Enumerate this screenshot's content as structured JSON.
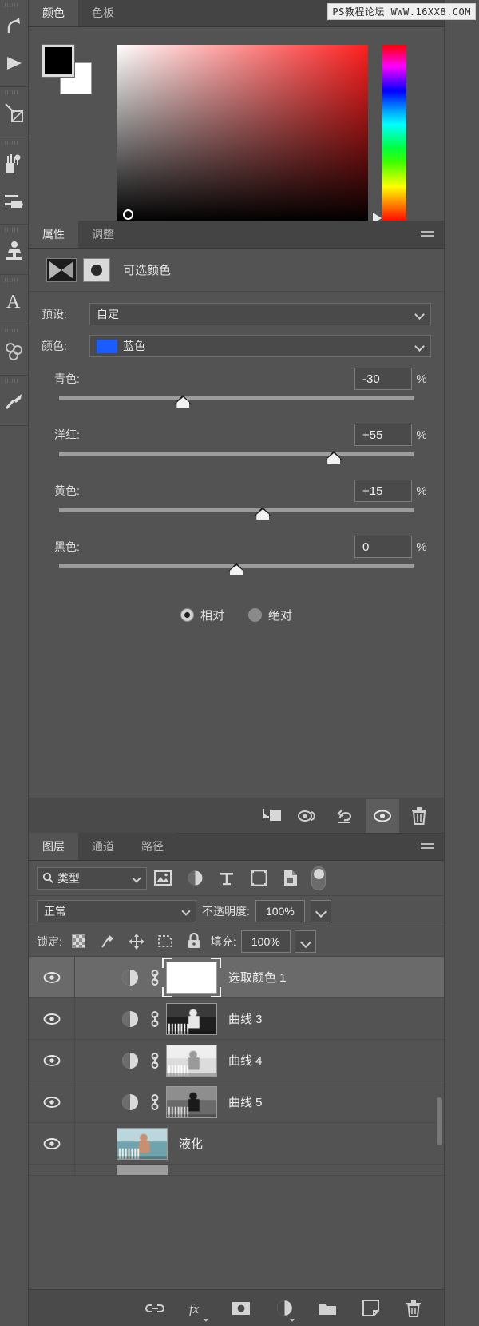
{
  "watermark": "PS教程论坛 WWW.16XX8.COM",
  "toolbar": {
    "tools": [
      {
        "name": "history-brush-tool",
        "glyph": "undo-arrow"
      },
      {
        "name": "gradient-tool",
        "glyph": "triangle-right"
      },
      {
        "name": "pen-tool",
        "glyph": "pen"
      },
      {
        "name": "brush-tool",
        "glyph": "brush-set"
      },
      {
        "name": "eraser-tool",
        "glyph": "eraser"
      },
      {
        "name": "clone-stamp-tool",
        "glyph": "stamp"
      },
      {
        "name": "type-tool",
        "glyph": "letter-a"
      },
      {
        "name": "blur-tool",
        "glyph": "blur"
      },
      {
        "name": "dodge-tool",
        "glyph": "dodge"
      }
    ]
  },
  "color_panel": {
    "tabs": [
      {
        "label": "颜色",
        "active": true
      },
      {
        "label": "色板",
        "active": false
      }
    ],
    "foreground": "#000000",
    "background": "#ffffff",
    "spectrum_base": "#ff1f1f"
  },
  "properties_panel": {
    "tabs": [
      {
        "label": "属性",
        "active": true
      },
      {
        "label": "调整",
        "active": false
      }
    ],
    "adjustment_title": "可选颜色",
    "preset": {
      "label": "预设:",
      "value": "自定"
    },
    "color": {
      "label": "颜色:",
      "value": "蓝色",
      "swatch": "#1a5cff"
    },
    "sliders": [
      {
        "label": "青色:",
        "value": "-30",
        "unit": "%",
        "pos": 35
      },
      {
        "label": "洋红:",
        "value": "+55",
        "unit": "%",
        "pos": 77.5
      },
      {
        "label": "黄色:",
        "value": "+15",
        "unit": "%",
        "pos": 57.5
      },
      {
        "label": "黑色:",
        "value": "0",
        "unit": "%",
        "pos": 50
      }
    ],
    "method": [
      {
        "label": "相对",
        "selected": true
      },
      {
        "label": "绝对",
        "selected": false
      }
    ],
    "footer_buttons": [
      {
        "name": "clip-to-layer-button",
        "active": false
      },
      {
        "name": "preview-toggle-button",
        "active": false
      },
      {
        "name": "reset-button",
        "active": false
      },
      {
        "name": "visibility-toggle-button",
        "active": true
      },
      {
        "name": "delete-adjustment-button",
        "active": false
      }
    ]
  },
  "layers_panel": {
    "tabs": [
      {
        "label": "图层",
        "active": true
      },
      {
        "label": "通道",
        "active": false
      },
      {
        "label": "路径",
        "active": false
      }
    ],
    "filter": {
      "value": "类型"
    },
    "filter_icons": [
      {
        "name": "filter-pixel-icon"
      },
      {
        "name": "filter-adjustment-icon"
      },
      {
        "name": "filter-type-icon"
      },
      {
        "name": "filter-shape-icon"
      },
      {
        "name": "filter-smart-object-icon"
      }
    ],
    "blend_mode": "正常",
    "opacity": {
      "label": "不透明度:",
      "value": "100%"
    },
    "lock": {
      "label": "锁定:",
      "fill_label": "填充:",
      "fill_value": "100%"
    },
    "lock_icons": [
      {
        "name": "lock-transparency-icon"
      },
      {
        "name": "lock-image-icon"
      },
      {
        "name": "lock-position-icon"
      },
      {
        "name": "lock-artboard-icon"
      },
      {
        "name": "lock-all-icon"
      }
    ],
    "layers": [
      {
        "name": "选取颜色 1",
        "type": "adjustment",
        "selected": true,
        "visible": true,
        "linked": true,
        "thumb": "white-mask"
      },
      {
        "name": "曲线 3",
        "type": "adjustment",
        "selected": false,
        "visible": true,
        "linked": true,
        "thumb": "photo-dark"
      },
      {
        "name": "曲线 4",
        "type": "adjustment",
        "selected": false,
        "visible": true,
        "linked": true,
        "thumb": "photo-light"
      },
      {
        "name": "曲线 5",
        "type": "adjustment",
        "selected": false,
        "visible": true,
        "linked": true,
        "thumb": "photo-mid"
      },
      {
        "name": "液化",
        "type": "pixel",
        "selected": false,
        "visible": true,
        "linked": false,
        "thumb": "photo-color"
      }
    ],
    "footer_buttons": [
      {
        "name": "link-layers-button"
      },
      {
        "name": "layer-style-fx-button"
      },
      {
        "name": "add-layer-mask-button"
      },
      {
        "name": "new-adjustment-layer-button"
      },
      {
        "name": "new-group-button"
      },
      {
        "name": "new-layer-button"
      },
      {
        "name": "delete-layer-button"
      }
    ]
  }
}
